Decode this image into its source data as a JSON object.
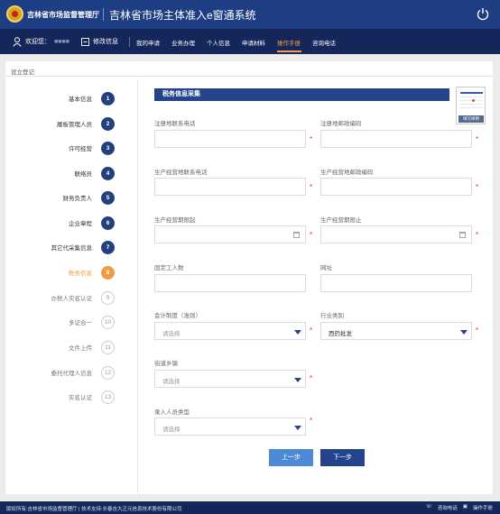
{
  "header": {
    "org_name": "吉林省市场监督管理厅",
    "system_title": "吉林省市场主体准入e窗通系统"
  },
  "nav": {
    "welcome": "欢迎您：",
    "username": "■■■■",
    "edit_info": "修改信息",
    "items": [
      "我的申请",
      "业务办理",
      "个人信息",
      "申请材料",
      "操作手册",
      "咨询电话"
    ],
    "active_item": "操作手册"
  },
  "breadcrumb": "设立登记",
  "steps": [
    {
      "num": "1",
      "label": "基本信息",
      "status": "done"
    },
    {
      "num": "2",
      "label": "履板管理人员",
      "status": "done"
    },
    {
      "num": "3",
      "label": "许可经营",
      "status": "done"
    },
    {
      "num": "4",
      "label": "联络员",
      "status": "done"
    },
    {
      "num": "5",
      "label": "财务负责人",
      "status": "done"
    },
    {
      "num": "6",
      "label": "企业章程",
      "status": "done"
    },
    {
      "num": "7",
      "label": "其它代采集信息",
      "status": "done"
    },
    {
      "num": "8",
      "label": "税务信息",
      "status": "current"
    },
    {
      "num": "9",
      "label": "办税人实名认证",
      "status": "pending"
    },
    {
      "num": "10",
      "label": "多证合一",
      "status": "pending"
    },
    {
      "num": "11",
      "label": "文件上传",
      "status": "pending"
    },
    {
      "num": "12",
      "label": "委托代理人信息",
      "status": "pending"
    },
    {
      "num": "13",
      "label": "实名认证",
      "status": "pending"
    }
  ],
  "form": {
    "section_title": "税务信息采集",
    "thumbnail_label": "填写样例",
    "fields": {
      "reg_phone": {
        "label": "注册地联系电话",
        "value": ""
      },
      "reg_postcode": {
        "label": "注册地邮政编码",
        "value": ""
      },
      "biz_phone": {
        "label": "生产经营地联系电话",
        "value": ""
      },
      "biz_postcode": {
        "label": "生产经营地邮政编码",
        "value": ""
      },
      "period_start": {
        "label": "生产经营期限起",
        "value": ""
      },
      "period_end": {
        "label": "生产经营期限止",
        "value": ""
      },
      "employee_count": {
        "label": "固定工人数",
        "value": ""
      },
      "website": {
        "label": "网址",
        "value": ""
      },
      "accounting_system": {
        "label": "会计制度（准则）",
        "value": "请选择"
      },
      "industry": {
        "label": "行业类别",
        "value": "西药批发"
      },
      "street": {
        "label": "街道乡镇",
        "value": "请选择"
      },
      "entry_person_type": {
        "label": "录入人员类型",
        "value": "请选择"
      }
    },
    "required_mark": "*"
  },
  "buttons": {
    "prev": "上一步",
    "next": "下一步"
  },
  "footer": {
    "copyright": "版权所有:吉林省市场监督管理厅 | 技术支持:长春吉大正元信息技术股份有限公司",
    "hotline": "咨询电话",
    "manual": "操作手册"
  },
  "colors": {
    "header": "#1e3e83",
    "nav": "#14265a",
    "accent": "#f19a3e",
    "step_done": "#24407c",
    "required": "#e0342a"
  }
}
